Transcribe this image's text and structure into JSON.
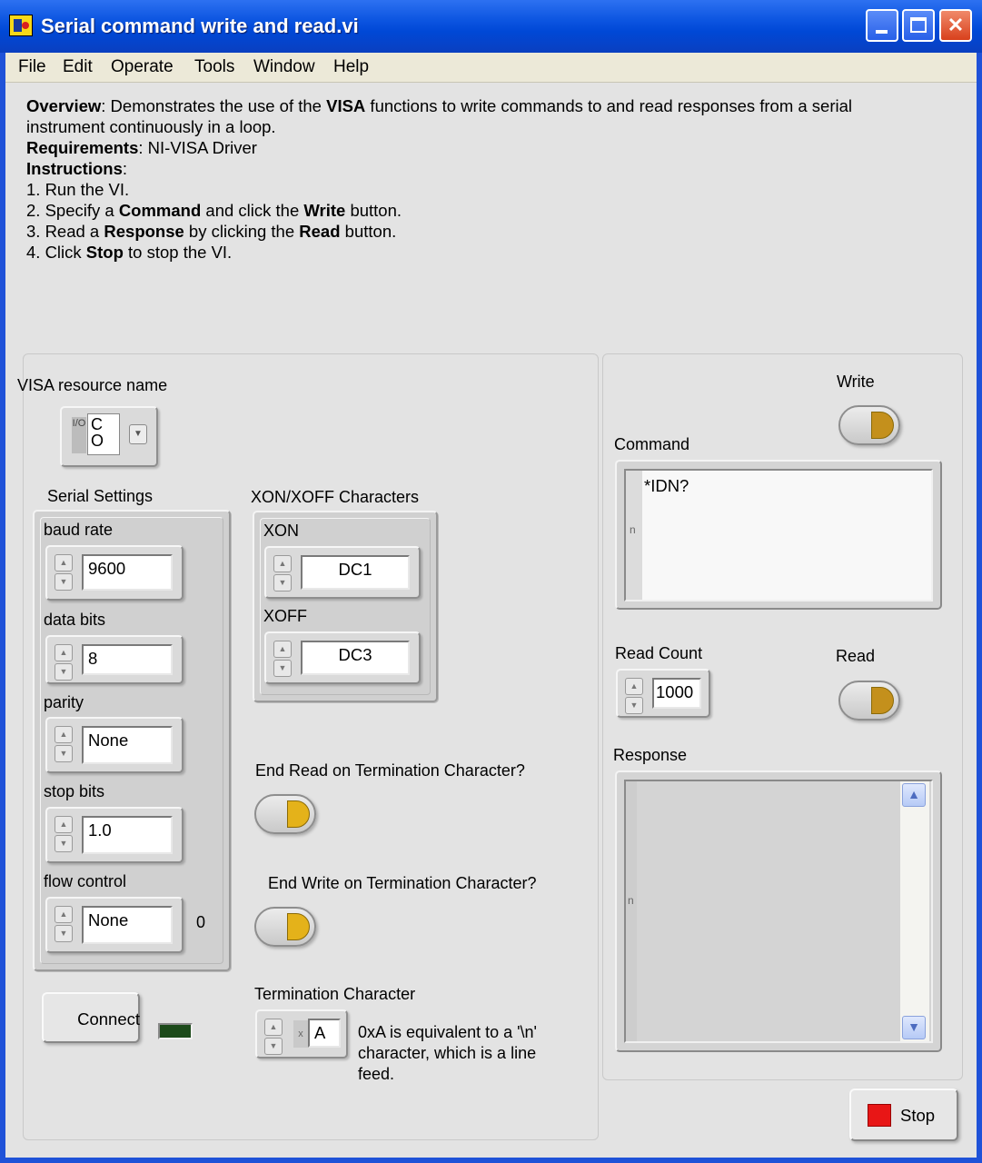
{
  "window": {
    "title": "Serial command write and read.vi"
  },
  "menu": {
    "items": [
      "File",
      "Edit",
      "Operate",
      "Tools",
      "Window",
      "Help"
    ]
  },
  "description": {
    "overview_label": "Overview",
    "overview_1": ": Demonstrates the use of the ",
    "overview_visa": "VISA",
    "overview_2": " functions to write commands to and read responses from a serial instrument continuously in a loop.",
    "requirements_label": "Requirements",
    "requirements_text": ": NI-VISA Driver",
    "instructions_label": "Instructions",
    "instructions_colon": ":",
    "step1": "1. Run the VI.",
    "step2_a": "2. Specify a ",
    "step2_b": "Command",
    "step2_c": " and click the ",
    "step2_d": "Write",
    "step2_e": " button.",
    "step3_a": "3. Read a ",
    "step3_b": "Response",
    "step3_c": " by clicking the ",
    "step3_d": "Read",
    "step3_e": " button.",
    "step4_a": "4. Click ",
    "step4_b": "Stop",
    "step4_c": " to stop the VI."
  },
  "visa": {
    "label": "VISA resource name",
    "io_text": "I/O",
    "value": "C\nO"
  },
  "serial_settings": {
    "label": "Serial Settings",
    "baud_rate_label": "baud rate",
    "baud_rate": "9600",
    "data_bits_label": "data bits",
    "data_bits": "8",
    "parity_label": "parity",
    "parity": "None",
    "stop_bits_label": "stop bits",
    "stop_bits": "1.0",
    "flow_control_label": "flow control",
    "flow_control": "None",
    "flow_control_index": "0"
  },
  "xonxoff": {
    "label": "XON/XOFF Characters",
    "xon_label": "XON",
    "xon": "DC1",
    "xoff_label": "XOFF",
    "xoff": "DC3"
  },
  "end_read": {
    "label": "End Read on Termination Character?"
  },
  "end_write": {
    "label": "End Write on Termination Character?"
  },
  "termination": {
    "label": "Termination Character",
    "hex_prefix": "x",
    "value": "A",
    "note": "0xA is equivalent to a '\\n' character, which is a line feed."
  },
  "connect": {
    "label": "Connect"
  },
  "write": {
    "label": "Write",
    "command_label": "Command",
    "command_value": "*IDN?",
    "display_mode": "n"
  },
  "read": {
    "label": "Read",
    "count_label": "Read Count",
    "count_value": "1000",
    "response_label": "Response",
    "response_value": "",
    "display_mode": "n"
  },
  "stop": {
    "label": "Stop"
  },
  "colors": {
    "titlebar": "#0b54e0",
    "panel_bg": "#e3e3e3",
    "led_on": "#e4b21a",
    "stop_red": "#e81616",
    "indicator_off": "#1c4a1a"
  },
  "icons": [
    "labview-vi-icon",
    "minimize-icon",
    "maximize-icon",
    "close-icon",
    "spin-up-icon",
    "spin-down-icon",
    "dropdown-icon",
    "scroll-up-icon",
    "scroll-down-icon",
    "stop-square-icon"
  ]
}
